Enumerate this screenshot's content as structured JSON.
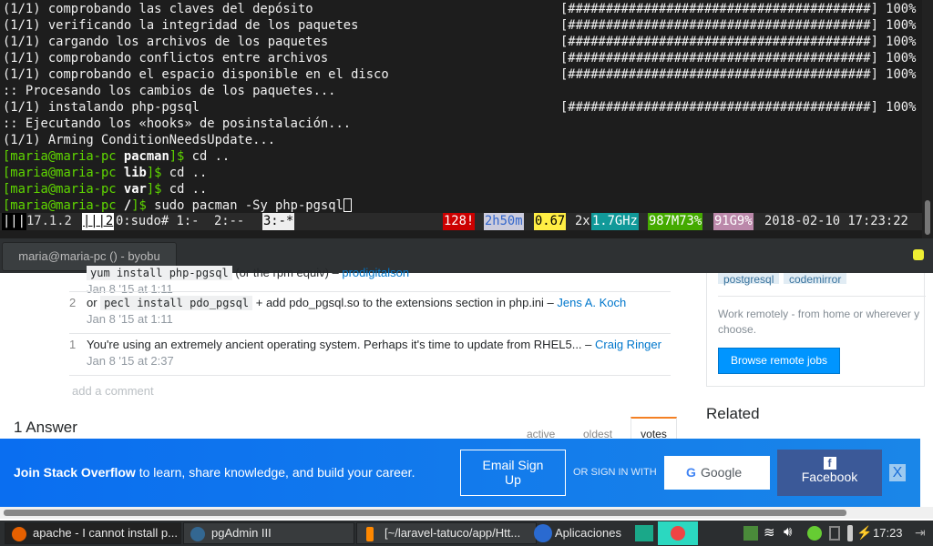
{
  "terminal": {
    "lines": [
      "(1/1) comprobando las claves del depósito",
      "(1/1) verificando la integridad de los paquetes",
      "(1/1) cargando los archivos de los paquetes",
      "(1/1) comprobando conflictos entre archivos",
      "(1/1) comprobando el espacio disponible en el disco",
      ":: Procesando los cambios de los paquetes...",
      "(1/1) instalando php-pgsql",
      ":: Ejecutando los «hooks» de posinstalación...",
      "(1/1) Arming ConditionNeedsUpdate..."
    ],
    "progress_bar": "[########################################] 100%",
    "progress_lines": [
      0,
      1,
      2,
      3,
      4,
      6
    ],
    "prompts": [
      {
        "user": "[maria@maria-pc ",
        "dir": "pacman",
        "end": "]$",
        "cmd": " cd .."
      },
      {
        "user": "[maria@maria-pc ",
        "dir": "lib",
        "end": "]$",
        "cmd": " cd .."
      },
      {
        "user": "[maria@maria-pc ",
        "dir": "var",
        "end": "]$",
        "cmd": " cd .."
      },
      {
        "user": "[maria@maria-pc ",
        "dir": "/",
        "end": "]$",
        "cmd": " sudo pacman -Sy php-pgsql"
      }
    ],
    "status": {
      "logo": "|||",
      "version": "17.1.2",
      "windows_badge": "|||2",
      "windows": "0:sudo# 1:-  2:--",
      "active_window": "3:-*",
      "updates": "128!",
      "uptime": "2h50m",
      "load": "0.67",
      "cpu_count": "2x",
      "cpu_freq": "1.7GHz",
      "memory": "987M73%",
      "disk": "91G9%",
      "datetime": "2018-02-10 17:23:22"
    }
  },
  "window_tab": "maria@maria-pc () - byobu",
  "comments": [
    {
      "votes": "",
      "pre": "",
      "code": "yum install php-pgsql",
      "post": " (or the rpm equiv) – ",
      "author": "prodigitalson",
      "date": "Jan 8 '15 at 1:11"
    },
    {
      "votes": "2",
      "pre": "or ",
      "code": "pecl install pdo_pgsql",
      "post": " + add pdo_pgsql.so to the extensions section in php.ini – ",
      "author": "Jens A. Koch",
      "date": "Jan 8 '15 at 1:11"
    },
    {
      "votes": "1",
      "pre": "You're using an extremely ancient operating system. Perhaps it's time to update from RHEL5... – ",
      "code": "",
      "post": "",
      "author": "Craig Ringer",
      "date": "Jan 8 '15 at 2:37"
    }
  ],
  "add_comment": "add a comment",
  "answers_heading": "1 Answer",
  "sort_tabs": [
    "active",
    "oldest",
    "votes"
  ],
  "sidebar": {
    "tags": [
      "postgresql",
      "codemirror"
    ],
    "remote_text": "Work remotely - from home or wherever y",
    "remote_text2": "choose.",
    "browse_button": "Browse remote jobs",
    "related": "Related"
  },
  "banner": {
    "bold": "Join Stack Overflow",
    "text": " to learn, share knowledge, and build your career.",
    "email_button": "Email Sign Up",
    "or_sign_in": "OR SIGN IN WITH",
    "google": "Google",
    "facebook": "Facebook",
    "close": "X"
  },
  "taskbar": {
    "tasks": [
      "apache - I cannot install p...",
      "pgAdmin III",
      "[~/laravel-tatuco/app/Htt..."
    ],
    "apps_menu": "Aplicaciones",
    "clock": "17:23"
  },
  "colors": {
    "accent": "#0077cc",
    "banner": "#0a75ee",
    "facebook": "#3b5998",
    "prompt_green": "#5fd700"
  }
}
